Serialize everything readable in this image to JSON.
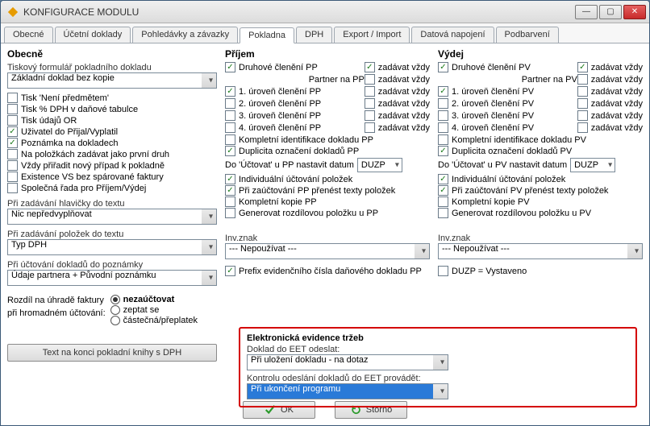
{
  "window": {
    "title": "KONFIGURACE MODULU"
  },
  "tabs": {
    "items": [
      "Obecné",
      "Účetní doklady",
      "Pohledávky a závazky",
      "Pokladna",
      "DPH",
      "Export / Import",
      "Datová napojení",
      "Podbarvení"
    ],
    "active": 3
  },
  "left": {
    "header": "Obecně",
    "print_form_label": "Tiskový formulář pokladního dokladu",
    "print_form_value": "Základní doklad bez kopie",
    "checks": [
      {
        "label": "Tisk 'Není předmětem'",
        "checked": false
      },
      {
        "label": "Tisk % DPH v daňové tabulce",
        "checked": false
      },
      {
        "label": "Tisk údajů OR",
        "checked": false
      },
      {
        "label": "Uživatel do Přijal/Vyplatil",
        "checked": true
      },
      {
        "label": "Poznámka na dokladech",
        "checked": true
      },
      {
        "label": "Na položkách zadávat jako první druh",
        "checked": false
      },
      {
        "label": "Vždy přiřadit nový případ k pokladně",
        "checked": false
      },
      {
        "label": "Existence VS bez spárované faktury",
        "checked": false
      },
      {
        "label": "Společná řada pro Příjem/Výdej",
        "checked": false
      }
    ],
    "header_text_label": "Při zadávání hlavičky do textu",
    "header_text_value": "Nic nepředvyplňovat",
    "items_text_label": "Při zadávání položek do textu",
    "items_text_value": "Typ DPH",
    "note_label": "Při účtování dokladů do poznámky",
    "note_value": "Údaje partnera + Původní poznámku",
    "diff_label_1": "Rozdíl na úhradě faktury",
    "diff_label_2": "při hromadném účtování:",
    "diff_opts": [
      "nezaúčtovat",
      "zeptat se",
      "částečná/přeplatek"
    ],
    "diff_selected": 0,
    "bottom_button": "Text na konci pokladní knihy s DPH"
  },
  "prijem": {
    "header": "Příjem",
    "rows": [
      {
        "l": "Druhové členění PP",
        "lc": true,
        "r": "zadávat vždy",
        "rc": true
      },
      {
        "l": "Partner na PP",
        "lc": null,
        "r": "zadávat vždy",
        "rc": false
      },
      {
        "l": "1. úroveň členění PP",
        "lc": true,
        "r": "zadávat vždy",
        "rc": false
      },
      {
        "l": "2. úroveň členění PP",
        "lc": false,
        "r": "zadávat vždy",
        "rc": false
      },
      {
        "l": "3. úroveň členění PP",
        "lc": false,
        "r": "zadávat vždy",
        "rc": false
      },
      {
        "l": "4. úroveň členění PP",
        "lc": false,
        "r": "zadávat vždy",
        "rc": false
      }
    ],
    "extra": [
      {
        "label": "Kompletní identifikace dokladu PP",
        "checked": false
      },
      {
        "label": "Duplicita označení dokladů PP",
        "checked": true
      }
    ],
    "date_label": "Do 'Účtovat' u PP nastavit datum",
    "date_value": "DUZP",
    "tail": [
      {
        "label": "Individuální účtování položek",
        "checked": true
      },
      {
        "label": "Při zaúčtování PP přenést texty položek",
        "checked": true
      },
      {
        "label": "Kompletní kopie PP",
        "checked": false
      },
      {
        "label": "Generovat rozdílovou položku u PP",
        "checked": false
      }
    ],
    "inv_label": "Inv.znak",
    "inv_value": "--- Nepoužívat ---",
    "prefix_label": "Prefix evidenčního čísla daňového dokladu PP",
    "prefix_checked": true
  },
  "vydej": {
    "header": "Výdej",
    "rows": [
      {
        "l": "Druhové členění PV",
        "lc": true,
        "r": "zadávat vždy",
        "rc": true
      },
      {
        "l": "Partner na PV",
        "lc": null,
        "r": "zadávat vždy",
        "rc": false
      },
      {
        "l": "1. úroveň členění PV",
        "lc": true,
        "r": "zadávat vždy",
        "rc": false
      },
      {
        "l": "2. úroveň členění PV",
        "lc": false,
        "r": "zadávat vždy",
        "rc": false
      },
      {
        "l": "3. úroveň členění PV",
        "lc": false,
        "r": "zadávat vždy",
        "rc": false
      },
      {
        "l": "4. úroveň členění PV",
        "lc": false,
        "r": "zadávat vždy",
        "rc": false
      }
    ],
    "extra": [
      {
        "label": "Kompletní identifikace dokladu PV",
        "checked": false
      },
      {
        "label": "Duplicita označení dokladů PV",
        "checked": true
      }
    ],
    "date_label": "Do 'Účtovat' u PV nastavit datum",
    "date_value": "DUZP",
    "tail": [
      {
        "label": "Individuální účtování položek",
        "checked": true
      },
      {
        "label": "Při zaúčtování PV přenést texty položek",
        "checked": true
      },
      {
        "label": "Kompletní kopie PV",
        "checked": false
      },
      {
        "label": "Generovat rozdílovou položku u PV",
        "checked": false
      }
    ],
    "inv_label": "Inv.znak",
    "inv_value": "--- Nepoužívat ---",
    "duzp_label": "DUZP = Vystaveno",
    "duzp_checked": false
  },
  "eet": {
    "header": "Elektronická evidence tržeb",
    "send_label": "Doklad do EET odeslat:",
    "send_value": "Při uložení dokladu - na dotaz",
    "check_label": "Kontrolu odeslání dokladů do EET provádět:",
    "check_value": "Při ukončení programu"
  },
  "footer": {
    "ok": "OK",
    "storno": "Storno"
  }
}
